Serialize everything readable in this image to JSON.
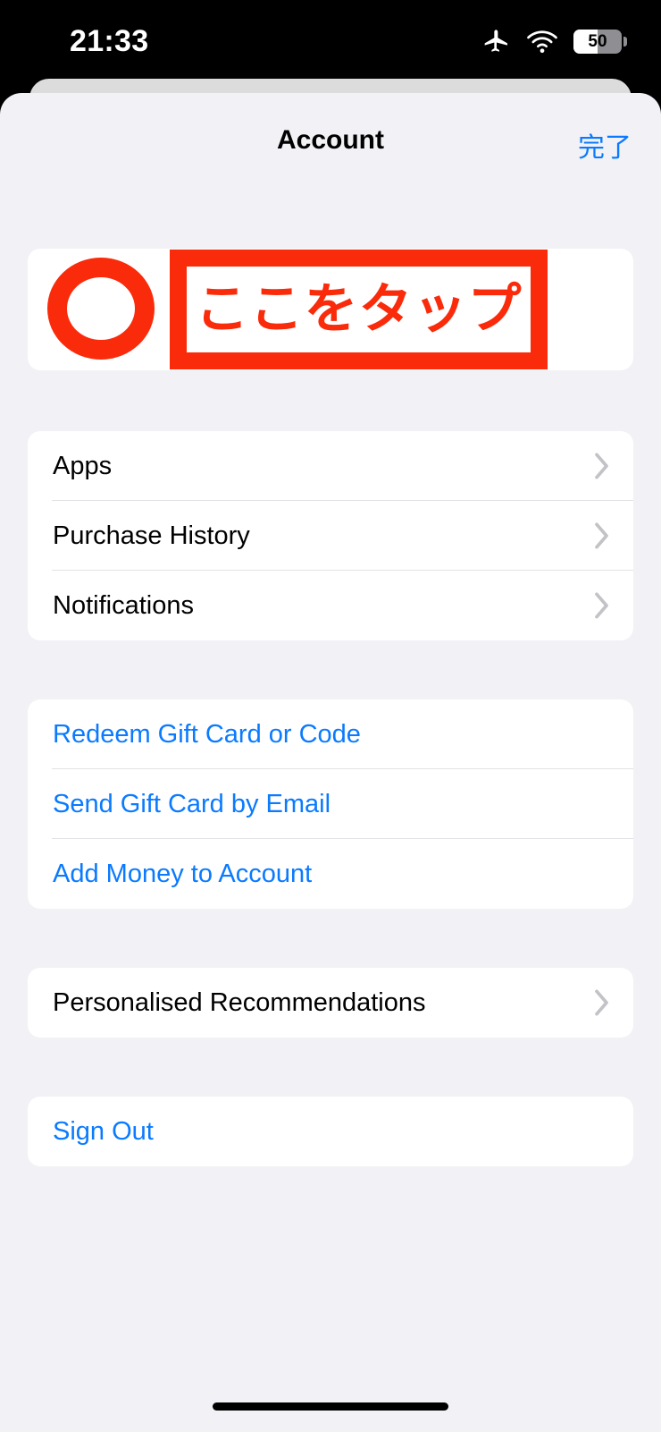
{
  "status_bar": {
    "time": "21:33",
    "icons": [
      "airplane-mode-icon",
      "wifi-icon",
      "battery-icon"
    ],
    "battery_percent": "50"
  },
  "nav_bar": {
    "title": "Account",
    "done_label": "完了"
  },
  "annotation": {
    "shape": "circle-marker",
    "text": "ここをタップ",
    "color": "#FA2B0A"
  },
  "groups": [
    {
      "name": "account-links-group",
      "rows": [
        {
          "label": "Apps",
          "style": "default",
          "chevron": true
        },
        {
          "label": "Purchase History",
          "style": "default",
          "chevron": true
        },
        {
          "label": "Notifications",
          "style": "default",
          "chevron": true
        }
      ]
    },
    {
      "name": "gift-card-group",
      "rows": [
        {
          "label": "Redeem Gift Card or Code",
          "style": "link",
          "chevron": false
        },
        {
          "label": "Send Gift Card by Email",
          "style": "link",
          "chevron": false
        },
        {
          "label": "Add Money to Account",
          "style": "link",
          "chevron": false
        }
      ]
    },
    {
      "name": "recommendations-group",
      "rows": [
        {
          "label": "Personalised Recommendations",
          "style": "default",
          "chevron": true
        }
      ]
    },
    {
      "name": "sign-out-group",
      "rows": [
        {
          "label": "Sign Out",
          "style": "link",
          "chevron": false
        }
      ]
    }
  ],
  "colors": {
    "background": "#F2F1F6",
    "card": "#FFFFFF",
    "accent_blue": "#0A7AFF",
    "annotation_red": "#FA2B0A",
    "separator": "#E2E2E6",
    "chevron": "#C3C3C7"
  },
  "home_indicator": "home-indicator"
}
